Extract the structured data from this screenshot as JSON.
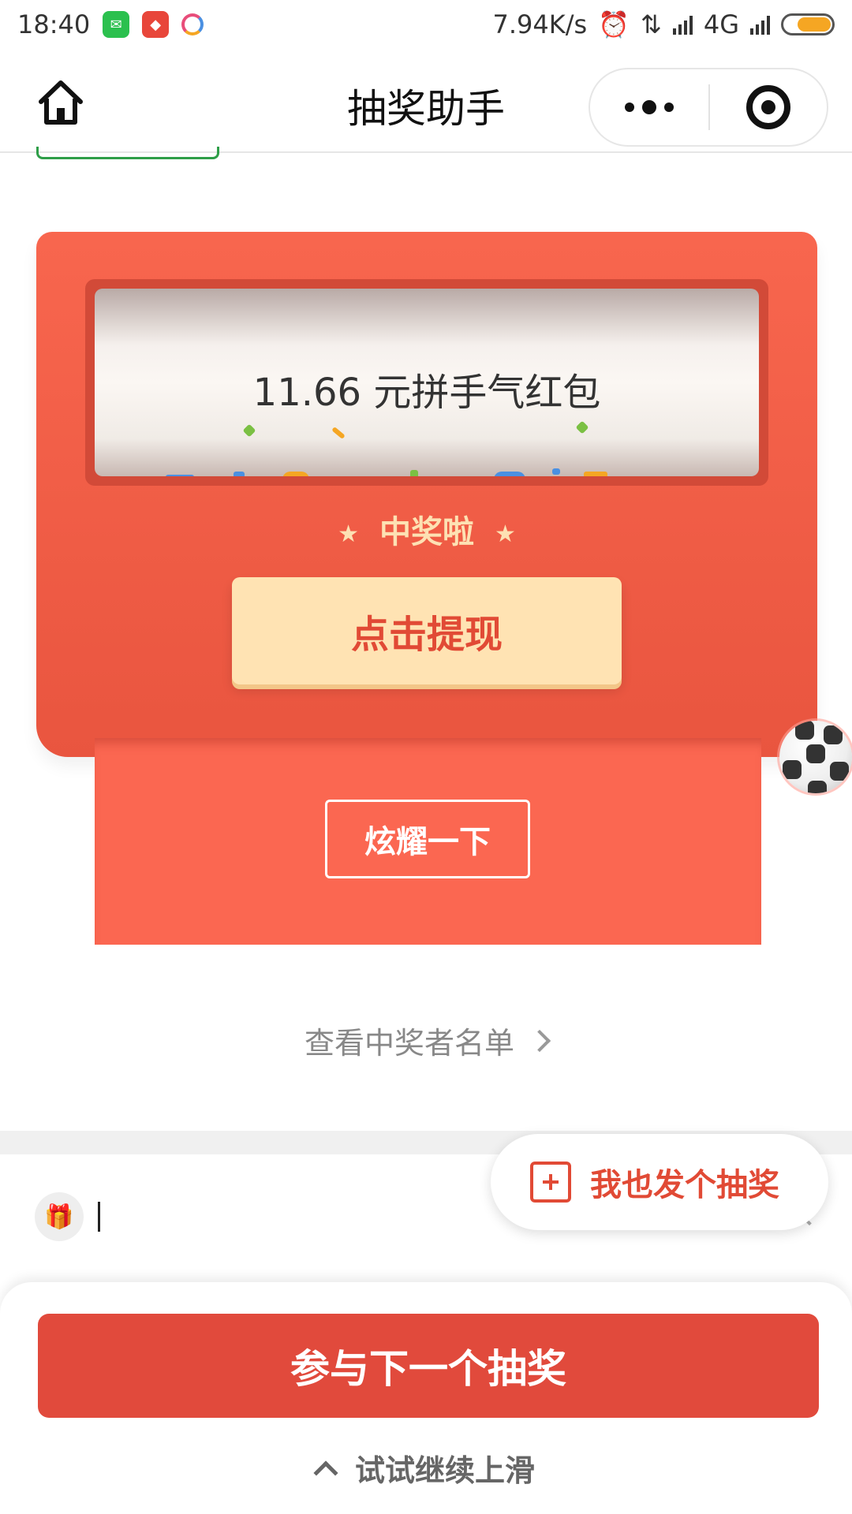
{
  "status_bar": {
    "time": "18:40",
    "net_speed": "7.94K/s",
    "network": "4G",
    "battery_color": "#f5a623",
    "icons": [
      "wechat-icon",
      "app-red-icon",
      "app-ring-icon",
      "alarm-icon",
      "data-arrows-icon",
      "signal-icon",
      "battery-icon"
    ]
  },
  "nav": {
    "title": "抽奖助手",
    "home_icon": "home-icon",
    "more_icon": "more-dots-icon",
    "close_icon": "target-close-icon"
  },
  "card": {
    "prize": "11.66 元拼手气红包",
    "win_label": "中奖啦",
    "withdraw_label": "点击提现",
    "show_off_label": "炫耀一下",
    "accent": "#f8664e",
    "button_bg": "#ffe3b3"
  },
  "winners_link": "查看中奖者名单",
  "float_create": {
    "label": "我也发个抽奖",
    "icon": "plus-box-icon"
  },
  "entry_row": {
    "avatar_icon": "gift-box-icon"
  },
  "bottom": {
    "join_label": "参与下一个抽奖",
    "swipe_hint": "试试继续上滑",
    "brand_red": "#e14a3c"
  }
}
